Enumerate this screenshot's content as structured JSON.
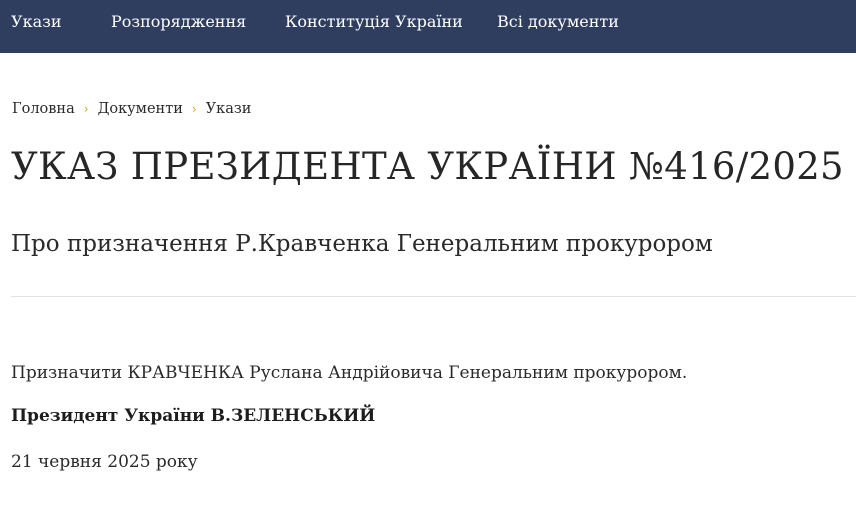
{
  "nav": {
    "items": [
      {
        "label": "Укази"
      },
      {
        "label": "Розпорядження"
      },
      {
        "label": "Конституція України"
      },
      {
        "label": "Всі документи"
      }
    ],
    "background_color": "#2f3e5e"
  },
  "breadcrumb": {
    "items": [
      {
        "label": "Головна"
      },
      {
        "label": "Документи"
      },
      {
        "label": "Укази"
      }
    ],
    "separator": "›",
    "separator_color": "#d9a520"
  },
  "document": {
    "title": "УКАЗ ПРЕЗИДЕНТА УКРАЇНИ №416/2025",
    "subtitle": "Про призначення Р.Кравченка Генеральним прокурором",
    "body": "Призначити КРАВЧЕНКА Руслана Андрійовича Генеральним прокурором.",
    "signature": "Президент України В.ЗЕЛЕНСЬКИЙ",
    "date": "21 червня 2025 року"
  }
}
